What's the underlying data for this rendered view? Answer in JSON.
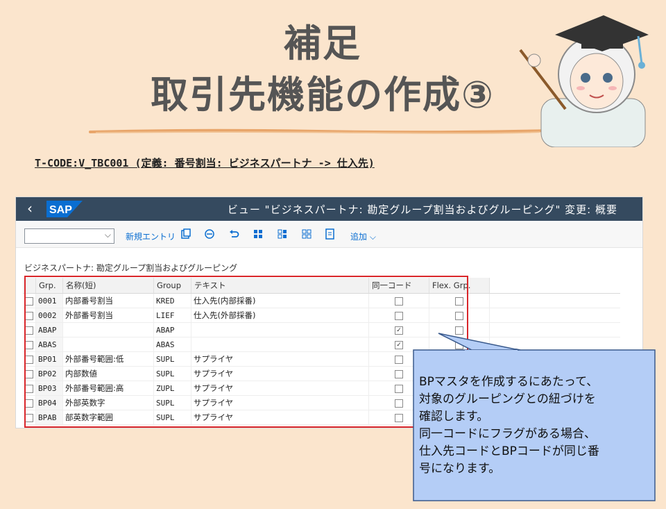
{
  "slide": {
    "title_line1": "補足",
    "title_line2": "取引先機能の作成③",
    "tcode": "T-CODE:V_TBC001 (定義: 番号割当: ビジネスパートナ -> 仕入先)"
  },
  "sap_window": {
    "back_glyph": "‹",
    "logo_text": "SAP",
    "title": "ビュー \"ビジネスパートナ: 勘定グループ割当およびグルーピング\" 変更: 概要",
    "toolbar": {
      "dropdown_value": "",
      "new_entry_label": "新規エントリ",
      "add_label": "追加",
      "icons": [
        "copy-icon",
        "delete-icon",
        "undo-icon",
        "select-all-icon",
        "deselect-icon",
        "select-block-icon",
        "details-icon"
      ]
    },
    "section_title": "ビジネスパートナ: 勘定グループ割当およびグルーピング",
    "table": {
      "headers": [
        "Grp.",
        "名称(短)",
        "Group",
        "テキスト",
        "同一コード",
        "Flex. Grp."
      ],
      "rows": [
        {
          "grp": "0001",
          "name": "内部番号割当",
          "group": "KRED",
          "text": "仕入先(内部採番)",
          "same_code": false,
          "flex": false
        },
        {
          "grp": "0002",
          "name": "外部番号割当",
          "group": "LIEF",
          "text": "仕入先(外部採番)",
          "same_code": false,
          "flex": false
        },
        {
          "grp": "ABAP",
          "name": "",
          "group": "ABAP",
          "text": "",
          "same_code": true,
          "flex": false
        },
        {
          "grp": "ABAS",
          "name": "",
          "group": "ABAS",
          "text": "",
          "same_code": true,
          "flex": false
        },
        {
          "grp": "BP01",
          "name": "外部番号範囲:低",
          "group": "SUPL",
          "text": "サプライヤ",
          "same_code": false,
          "flex": false
        },
        {
          "grp": "BP02",
          "name": "内部数値",
          "group": "SUPL",
          "text": "サプライヤ",
          "same_code": false,
          "flex": false
        },
        {
          "grp": "BP03",
          "name": "外部番号範囲:高",
          "group": "ZUPL",
          "text": "サプライヤ",
          "same_code": false,
          "flex": false
        },
        {
          "grp": "BP04",
          "name": "外部英数字",
          "group": "SUPL",
          "text": "サプライヤ",
          "same_code": false,
          "flex": false
        },
        {
          "grp": "BPAB",
          "name": "部英数字範囲",
          "group": "SUPL",
          "text": "サプライヤ",
          "same_code": false,
          "flex": false
        }
      ]
    }
  },
  "callout": {
    "lines": [
      "BPマスタを作成するにあたって、",
      "対象のグルーピングとの紐づけを",
      "確認します。",
      "同一コードにフラグがある場合、",
      "仕入先コードとBPコードが同じ番",
      "号になります。"
    ]
  },
  "colors": {
    "background": "#fbe5cd",
    "shell_bar": "#354a5f",
    "highlight_border": "#d9262a",
    "callout_fill": "#b4cdf6",
    "title_text": "#555555"
  }
}
